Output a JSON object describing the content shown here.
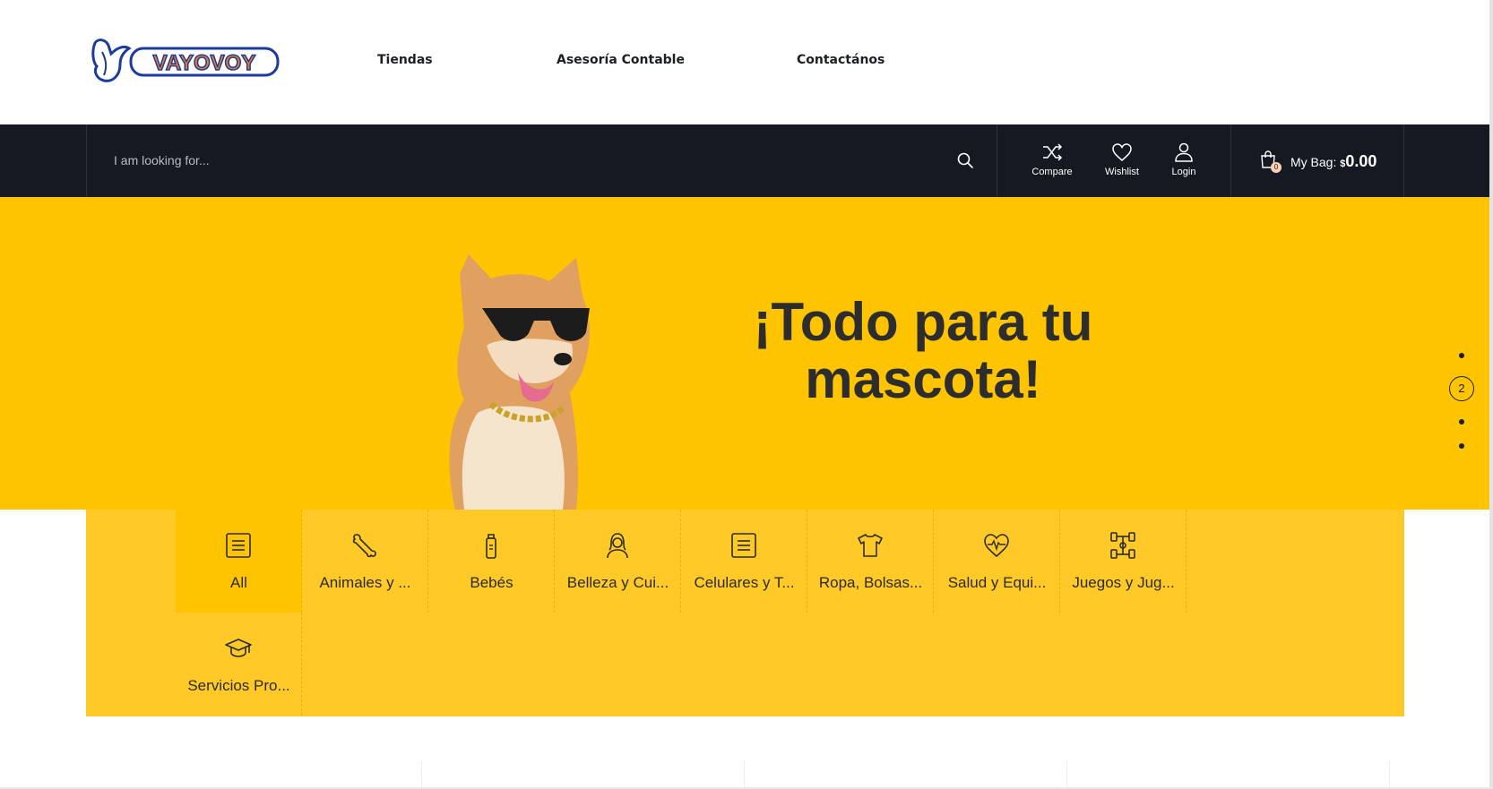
{
  "header": {
    "logo_text": "VAYOVOY",
    "nav": [
      {
        "label": "Tiendas"
      },
      {
        "label": "Asesoría Contable"
      },
      {
        "label": "Contactános"
      }
    ]
  },
  "search": {
    "placeholder": "I am looking for..."
  },
  "actions": {
    "compare": "Compare",
    "wishlist": "Wishlist",
    "login": "Login"
  },
  "bag": {
    "label": "My Bag:",
    "currency": "$",
    "amount": "0.00",
    "count": "0"
  },
  "hero": {
    "title_line1": "¡Todo para tu",
    "title_line2": "mascota!",
    "active_slide": "2"
  },
  "categories": [
    {
      "label": "All",
      "icon": "list-icon"
    },
    {
      "label": "Animales y ...",
      "icon": "bone-icon"
    },
    {
      "label": "Bebés",
      "icon": "baby-bottle-icon"
    },
    {
      "label": "Belleza y Cui...",
      "icon": "woman-icon"
    },
    {
      "label": "Celulares y T...",
      "icon": "list-icon"
    },
    {
      "label": "Ropa, Bolsas...",
      "icon": "tshirt-icon"
    },
    {
      "label": "Salud y Equi...",
      "icon": "heart-pulse-icon"
    },
    {
      "label": "Juegos y Jug...",
      "icon": "toy-car-icon"
    },
    {
      "label": "Servicios Pro...",
      "icon": "graduation-cap-icon"
    }
  ],
  "colors": {
    "hero_yellow": "#ffc400",
    "category_yellow": "#ffca28",
    "dark_bar": "#151922",
    "logo_blue": "#1c3b9c",
    "logo_orange": "#f07c22"
  }
}
